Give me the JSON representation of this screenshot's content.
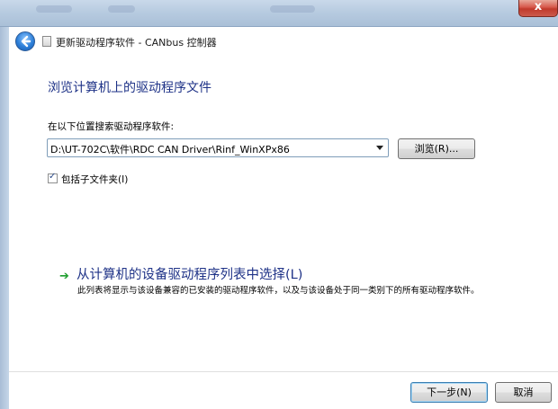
{
  "window": {
    "title": "更新驱动程序软件 - CANbus 控制器",
    "close_label": "x"
  },
  "page": {
    "heading": "浏览计算机上的驱动程序文件",
    "search_label": "在以下位置搜索驱动程序软件:",
    "path_value": "D:\\UT-702C\\软件\\RDC CAN Driver\\Rinf_WinXPx86",
    "browse_button": "浏览(R)...",
    "include_subfolders_label": "包括子文件夹(I)",
    "include_subfolders_checked": true,
    "pick_link_title": "从计算机的设备驱动程序列表中选择(L)",
    "pick_link_desc": "此列表将显示与该设备兼容的已安装的驱动程序软件，以及与该设备处于同一类别下的所有驱动程序软件。"
  },
  "footer": {
    "next_button": "下一步(N)",
    "cancel_button": "取消"
  },
  "icons": {
    "back": "back-arrow-icon",
    "device": "device-icon",
    "link_arrow": "green-arrow-icon",
    "dropdown": "chevron-down-icon"
  },
  "colors": {
    "heading": "#1e3287",
    "link_arrow": "#1e9e2e",
    "titlebar": "#b7cbe0"
  }
}
